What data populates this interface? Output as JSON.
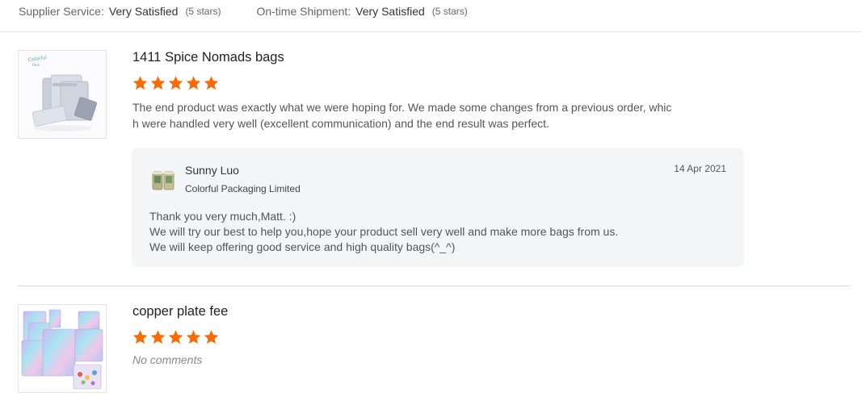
{
  "summary": {
    "supplier_service": {
      "label": "Supplier Service:",
      "value": "Very Satisfied",
      "stars": "(5 stars)"
    },
    "on_time_shipment": {
      "label": "On-time Shipment:",
      "value": "Very Satisfied",
      "stars": "(5 stars)"
    }
  },
  "colors": {
    "star": "#ff6a00",
    "reply_bg": "#f4f5f7",
    "divider": "#e6e6e6"
  },
  "reviews": [
    {
      "product_name": "1411 Spice Nomads bags",
      "rating": 5,
      "thumbnail_icon": "silver-pouch-bags-image",
      "comment_lines": [
        "The end product was exactly what we were hoping for. We made some changes from a previous order, whic",
        "h were handled very well (excellent communication) and the end result was perfect."
      ],
      "reply": {
        "name": "Sunny Luo",
        "company": "Colorful Packaging Limited",
        "date": "14 Apr 2021",
        "avatar_icon": "supplier-logo-icon",
        "lines": [
          "Thank you very much,Matt. :)",
          "We will try our best to help you,hope your product sell very well and make more bags from us.",
          "We will keep offering good service and high quality bags(^_^)"
        ]
      }
    },
    {
      "product_name": "copper plate fee",
      "rating": 5,
      "thumbnail_icon": "holographic-bags-image",
      "comment": "No comments"
    }
  ]
}
